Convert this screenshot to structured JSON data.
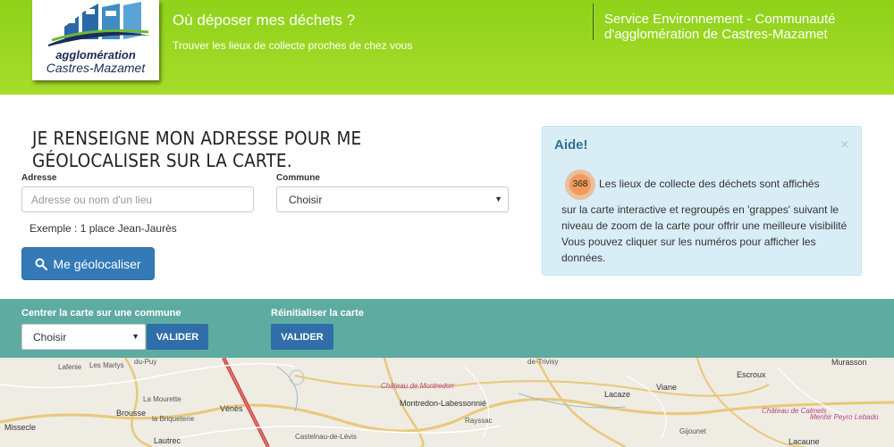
{
  "header": {
    "logo_line1": "agglomération",
    "logo_line2": "Castres-Mazamet",
    "title": "Où déposer mes déchets ?",
    "subtitle": "Trouver les lieux de collecte proches de chez vous",
    "service_line1": "Service Environnement - Communauté",
    "service_line2": "d'agglomération de Castres-Mazamet"
  },
  "form": {
    "title": "JE RENSEIGNE MON ADRESSE POUR ME GÉOLOCALISER SUR LA CARTE.",
    "address_label": "Adresse",
    "address_placeholder": "Adresse ou nom d'un lieu",
    "commune_label": "Commune",
    "commune_value": "Choisir",
    "example": "Exemple : 1 place Jean-Jaurès",
    "geolocate_label": "Me géolocaliser"
  },
  "help": {
    "title": "Aide!",
    "close": "×",
    "cluster_count": "368",
    "line1": "Les lieux de collecte des déchets sont affichés",
    "body": "sur la carte interactive et regroupés en 'grappes' suivant le niveau de zoom de la carte pour offrir une meilleure visibilité Vous pouvez cliquer sur les numéros pour afficher les données."
  },
  "bar": {
    "center_label": "Centrer la carte sur une commune",
    "center_value": "Choisir",
    "center_button": "VALIDER",
    "reset_label": "Réinitialiser la carte",
    "reset_button": "VALIDER"
  },
  "map": {
    "labels": [
      {
        "text": "du-Puy",
        "cls": ""
      },
      {
        "text": "Les Marlys",
        "cls": ""
      },
      {
        "text": "Lafenie",
        "cls": ""
      },
      {
        "text": "La Mourette",
        "cls": ""
      },
      {
        "text": "Brousse",
        "cls": "town"
      },
      {
        "text": "la Briqueterie",
        "cls": ""
      },
      {
        "text": "Vénès",
        "cls": "town"
      },
      {
        "text": "Lautrec",
        "cls": "town"
      },
      {
        "text": "Missecle",
        "cls": "town"
      },
      {
        "text": "Castelnau-de-Lévis",
        "cls": ""
      },
      {
        "text": "Château de Montredon",
        "cls": "pink"
      },
      {
        "text": "Montredon-Labessonnié",
        "cls": "town"
      },
      {
        "text": "Rayssac",
        "cls": ""
      },
      {
        "text": "Lacaze",
        "cls": "town"
      },
      {
        "text": "Viane",
        "cls": "town"
      },
      {
        "text": "Escroux",
        "cls": "town"
      },
      {
        "text": "Murasson",
        "cls": "town"
      },
      {
        "text": "Gijounet",
        "cls": ""
      },
      {
        "text": "Château de Calmels",
        "cls": "pink"
      },
      {
        "text": "Menhir Peyro Lebado",
        "cls": "pink"
      },
      {
        "text": "Lacaune",
        "cls": "town"
      },
      {
        "text": "de-Trivisy",
        "cls": ""
      }
    ]
  }
}
